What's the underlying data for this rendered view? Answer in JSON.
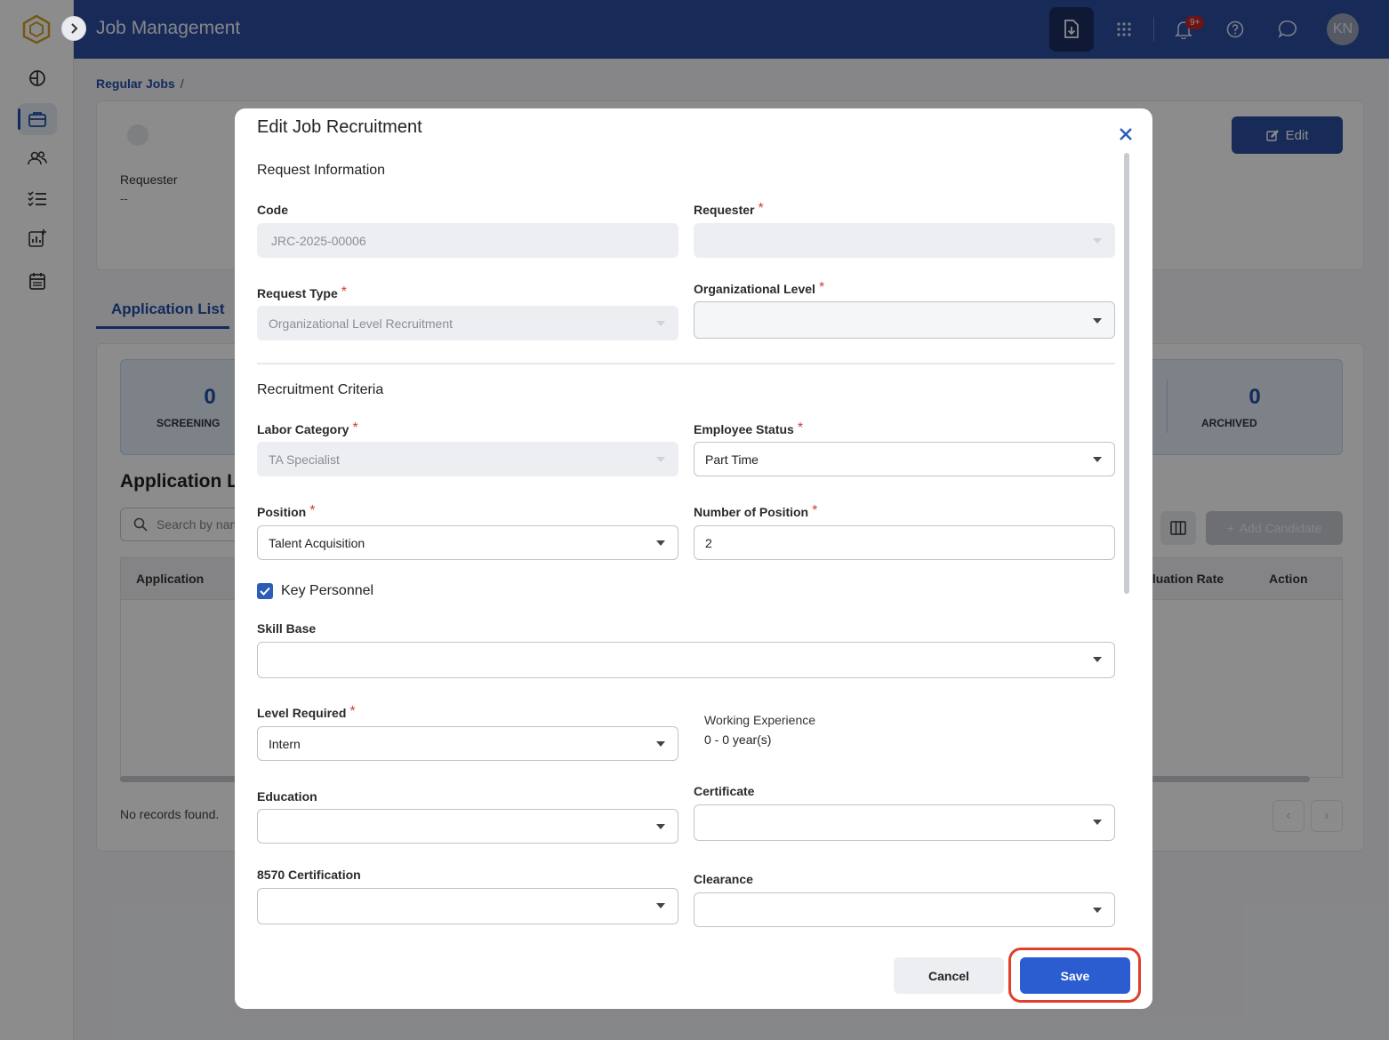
{
  "header": {
    "title": "Job Management",
    "notification_badge": "9+",
    "avatar_initials": "KN"
  },
  "breadcrumb": {
    "item": "Regular Jobs",
    "sep": "/"
  },
  "summary": {
    "requester_label": "Requester",
    "requester_value": "--",
    "edit_label": "Edit"
  },
  "tabs": {
    "application_list": "Application List"
  },
  "stats": [
    {
      "value": "0",
      "label": "SCREENING"
    },
    {
      "value": "0",
      "label": "ARCHIVED"
    }
  ],
  "list": {
    "title": "Application List",
    "search_placeholder": "Search by name",
    "add_candidate": "Add Candidate",
    "columns": {
      "application": "Application",
      "evaluation_rate": "Evaluation Rate",
      "action": "Action"
    },
    "empty_text": "No records found."
  },
  "modal": {
    "title": "Edit Job Recruitment",
    "section_request": "Request Information",
    "section_criteria": "Recruitment Criteria",
    "code": {
      "label": "Code",
      "value": "JRC-2025-00006"
    },
    "requester": {
      "label": "Requester",
      "value": ""
    },
    "request_type": {
      "label": "Request Type",
      "value": "Organizational Level Recruitment"
    },
    "org_level": {
      "label": "Organizational Level",
      "value": ""
    },
    "labor_category": {
      "label": "Labor Category",
      "value": "TA Specialist"
    },
    "employee_status": {
      "label": "Employee Status",
      "value": "Part Time"
    },
    "position": {
      "label": "Position",
      "value": "Talent Acquisition"
    },
    "number_of_position": {
      "label": "Number of Position",
      "value": "2"
    },
    "key_personnel": {
      "label": "Key Personnel",
      "checked": true
    },
    "skill_base": {
      "label": "Skill Base",
      "value": ""
    },
    "level_required": {
      "label": "Level Required",
      "value": "Intern"
    },
    "working_experience": {
      "label": "Working Experience",
      "value": "0 - 0 year(s)"
    },
    "education": {
      "label": "Education",
      "value": ""
    },
    "certificate": {
      "label": "Certificate",
      "value": ""
    },
    "cert_8570": {
      "label": "8570 Certification",
      "value": ""
    },
    "clearance": {
      "label": "Clearance",
      "value": ""
    },
    "cancel_label": "Cancel",
    "save_label": "Save"
  },
  "colors": {
    "primary": "#2b4da0",
    "save": "#2b5cd0",
    "highlight_ring": "#e0402a",
    "required": "#d23b3b"
  }
}
